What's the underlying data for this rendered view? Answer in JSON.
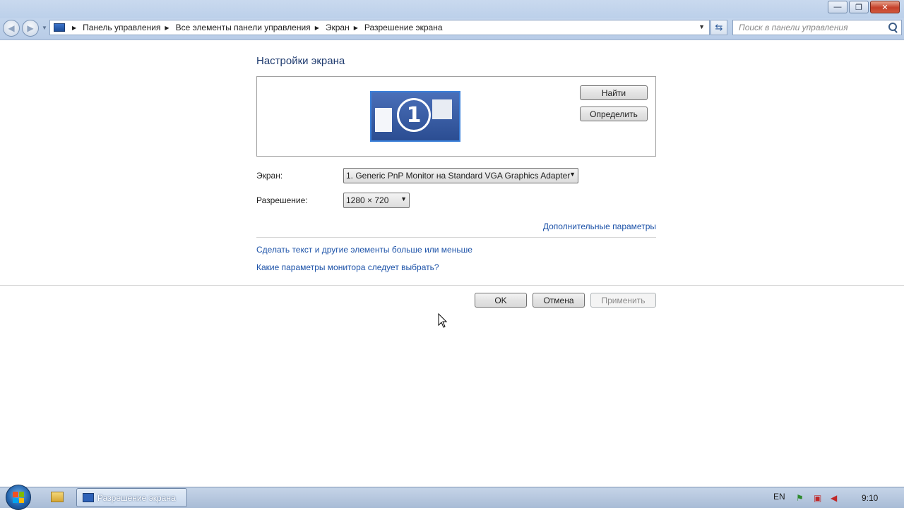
{
  "window": {
    "minimize_glyph": "—",
    "maximize_glyph": "❐",
    "close_glyph": "✕"
  },
  "address_bar": {
    "breadcrumbs": [
      "Панель управления",
      "Все элементы панели управления",
      "Экран",
      "Разрешение экрана"
    ]
  },
  "search": {
    "placeholder": "Поиск в панели управления"
  },
  "main": {
    "title": "Настройки экрана",
    "preview": {
      "monitor_number": "1",
      "find_button": "Найти",
      "identify_button": "Определить"
    },
    "display": {
      "label": "Экран:",
      "value": "1. Generic PnP Monitor на Standard VGA Graphics Adapter"
    },
    "resolution": {
      "label": "Разрешение:",
      "value": "1280 × 720"
    },
    "advanced_link": "Дополнительные параметры",
    "links": [
      "Сделать текст и другие элементы больше или меньше",
      "Какие параметры монитора следует выбрать?"
    ]
  },
  "footer": {
    "ok_button": "OK",
    "cancel_button": "Отмена",
    "apply_button": "Применить"
  },
  "taskbar": {
    "active_task": "Разрешение экрана",
    "language": "EN",
    "time": "9:10"
  },
  "colors": {
    "link": "#1c52a8",
    "heading": "#1e3a6e",
    "monitor_fill": "#2b4d92"
  }
}
